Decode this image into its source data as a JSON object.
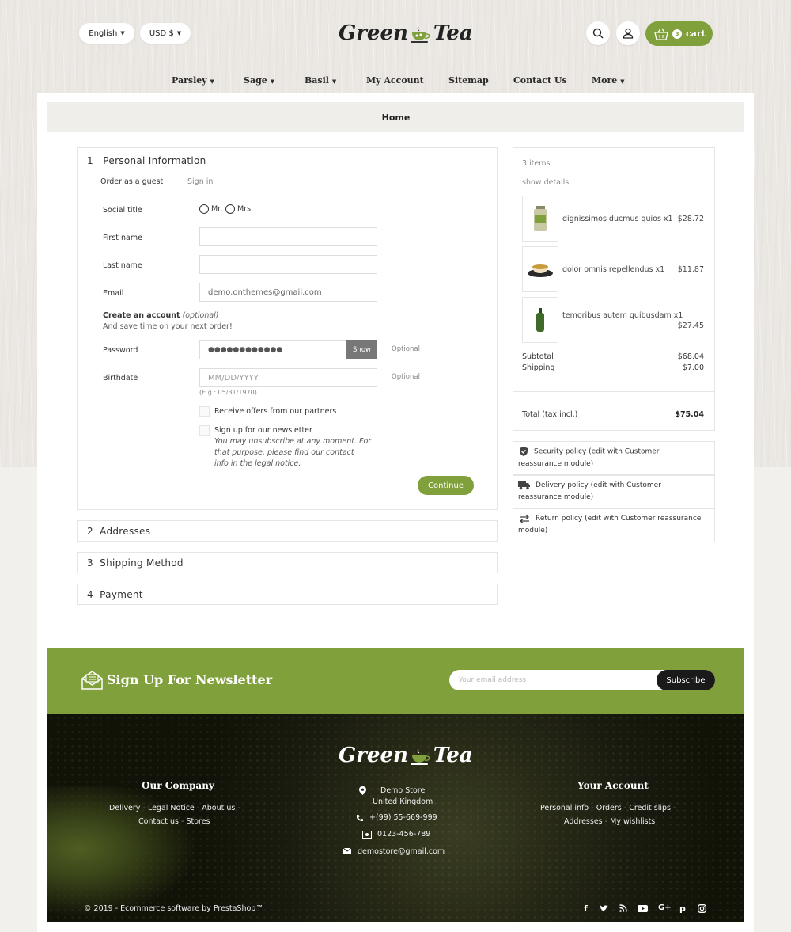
{
  "header": {
    "language": "English",
    "currency": "USD $",
    "logo_text_1": "Green",
    "logo_text_2": "Tea",
    "cart_count": "3",
    "cart_label": "cart",
    "nav": [
      "Parsley",
      "Sage",
      "Basil",
      "My Account",
      "Sitemap",
      "Contact Us",
      "More"
    ]
  },
  "breadcrumb": "Home",
  "checkout": {
    "step1": {
      "number": "1",
      "title": "Personal Information"
    },
    "guest_tab": "Order as a guest",
    "tab_sep": "|",
    "signin_tab": "Sign in",
    "social_title_label": "Social title",
    "mr": "Mr.",
    "mrs": "Mrs.",
    "first_name_label": "First name",
    "last_name_label": "Last name",
    "email_label": "Email",
    "email_value": "demo.onthemes@gmail.com",
    "create_account": "Create an account",
    "create_account_optional": "(optional)",
    "create_account_hint": "And save time on your next order!",
    "password_label": "Password",
    "password_value": "●●●●●●●●●●●●",
    "show_button": "Show",
    "optional": "Optional",
    "birthdate_label": "Birthdate",
    "birthdate_placeholder": "MM/DD/YYYY",
    "birthdate_example": "(E.g.: 05/31/1970)",
    "partners_offer": "Receive offers from our partners",
    "newsletter_signup": "Sign up for our newsletter",
    "newsletter_note_1": "You may unsubscribe at any moment. For",
    "newsletter_note_2": "that purpose, please find our contact",
    "newsletter_note_3": "info in the legal notice.",
    "continue": "Continue",
    "step2": {
      "number": "2",
      "title": "Addresses"
    },
    "step3": {
      "number": "3",
      "title": "Shipping Method"
    },
    "step4": {
      "number": "4",
      "title": "Payment"
    }
  },
  "summary": {
    "items_count": "3 items",
    "show_details": "show details",
    "products": [
      {
        "name": "dignissimos ducmus quios x1",
        "price": "$28.72"
      },
      {
        "name": "dolor omnis repellendus x1",
        "price": "$11.87"
      },
      {
        "name": "temoribus autem quibusdam x1",
        "price": "$27.45"
      }
    ],
    "subtotal_label": "Subtotal",
    "subtotal_value": "$68.04",
    "shipping_label": "Shipping",
    "shipping_value": "$7.00",
    "total_label": "Total (tax incl.)",
    "total_value": "$75.04"
  },
  "reassurance": [
    {
      "line1": "Security policy (edit with Customer",
      "line2": "reassurance module)"
    },
    {
      "line1": "Delivery policy (edit with Customer",
      "line2": "reassurance module)"
    },
    {
      "line1": "Return policy (edit with Customer reassurance",
      "line2": "module)"
    }
  ],
  "newsletter": {
    "title": "Sign Up For Newsletter",
    "placeholder": "Your email address",
    "button": "Subscribe"
  },
  "footer": {
    "logo_text_1": "Green",
    "logo_text_2": "Tea",
    "company_title": "Our Company",
    "company_links": [
      "Delivery",
      "Legal Notice",
      "About us",
      "Contact us",
      "Stores"
    ],
    "store_line1": "Demo Store",
    "store_line2": "United Kingdom",
    "phone": "+(99) 55-669-999",
    "fax": "0123-456-789",
    "email": "demostore@gmail.com",
    "account_title": "Your Account",
    "account_links": [
      "Personal info",
      "Orders",
      "Credit slips",
      "Addresses",
      "My wishlists"
    ],
    "copyright": "© 2019 - Ecommerce software by PrestaShop™",
    "social": [
      "f",
      "t",
      "rss",
      "yt",
      "G+",
      "p",
      "ig"
    ]
  },
  "colors": {
    "accent": "#7fa03b",
    "dark": "#1a1a1a"
  }
}
